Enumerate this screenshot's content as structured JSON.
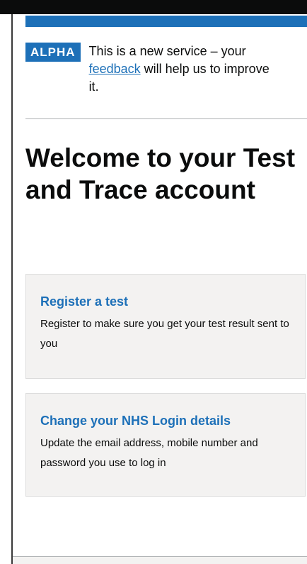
{
  "phase_banner": {
    "tag": "ALPHA",
    "text_before": "This is a new service – your ",
    "link": "feedback",
    "text_after": " will help us to improve it."
  },
  "page": {
    "title": "Welcome to your Test and Trace account"
  },
  "cards": [
    {
      "title": "Register a test",
      "description": "Register to make sure you get your test result sent to you"
    },
    {
      "title": "Change your NHS Login details",
      "description": "Update the email address, mobile number and password you use to log in"
    }
  ],
  "colors": {
    "brand_blue": "#1d70b8",
    "card_background": "#f3f2f1",
    "text": "#0b0c0c"
  }
}
